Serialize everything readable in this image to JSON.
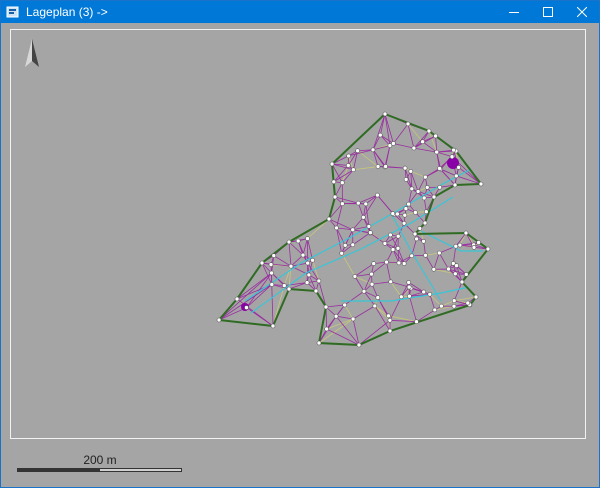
{
  "window": {
    "title": "Lageplan (3) ->",
    "controls": {
      "minimize": "minimize-icon",
      "maximize": "maximize-icon",
      "close": "close-icon"
    }
  },
  "map": {
    "north_arrow": "north-arrow-icon",
    "scale_label": "200 m",
    "colors": {
      "background": "#a5a5a5",
      "boundary": "#2f6b22",
      "triangulation": "#9a2fa0",
      "breaklines": "#37c6d8",
      "hatching": "#c8c87a",
      "points": "#ffffff",
      "highlight": "#8a00a8"
    }
  }
}
